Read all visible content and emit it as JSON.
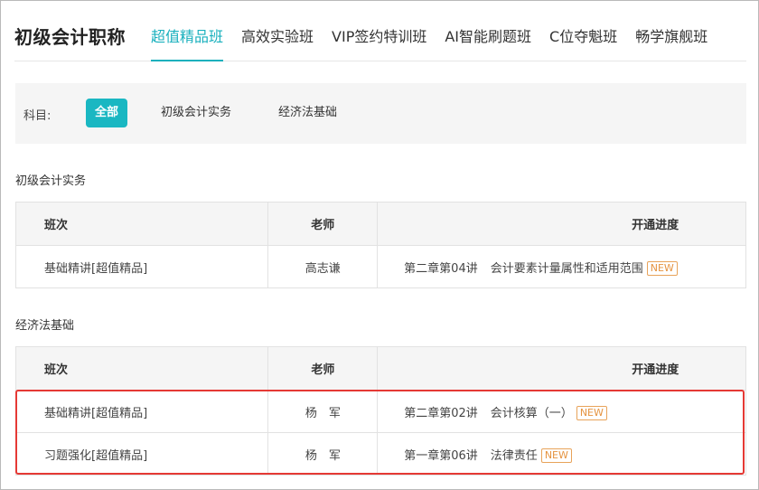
{
  "header": {
    "title": "初级会计职称",
    "tabs": [
      "超值精品班",
      "高效实验班",
      "VIP签约特训班",
      "AI智能刷题班",
      "C位夺魁班",
      "畅学旗舰班"
    ]
  },
  "filter": {
    "label": "科目:",
    "options": [
      "全部",
      "初级会计实务",
      "经济法基础"
    ]
  },
  "table_headers": [
    "班次",
    "老师",
    "开通进度"
  ],
  "sections": [
    {
      "title": "初级会计实务",
      "rows": [
        {
          "course": "基础精讲[超值精品]",
          "teacher": "高志谦",
          "chapter": "第二章第04讲",
          "topic": "会计要素计量属性和适用范围",
          "badge": "NEW"
        }
      ]
    },
    {
      "title": "经济法基础",
      "rows": [
        {
          "course": "基础精讲[超值精品]",
          "teacher": "杨　军",
          "chapter": "第二章第02讲",
          "topic": "会计核算（一）",
          "badge": "NEW"
        },
        {
          "course": "习题强化[超值精品]",
          "teacher": "杨　军",
          "chapter": "第一章第06讲",
          "topic": "法律责任",
          "badge": "NEW"
        }
      ]
    }
  ],
  "colors": {
    "accent": "#19b0bd",
    "badge": "#e59340",
    "highlight": "#e53935"
  }
}
